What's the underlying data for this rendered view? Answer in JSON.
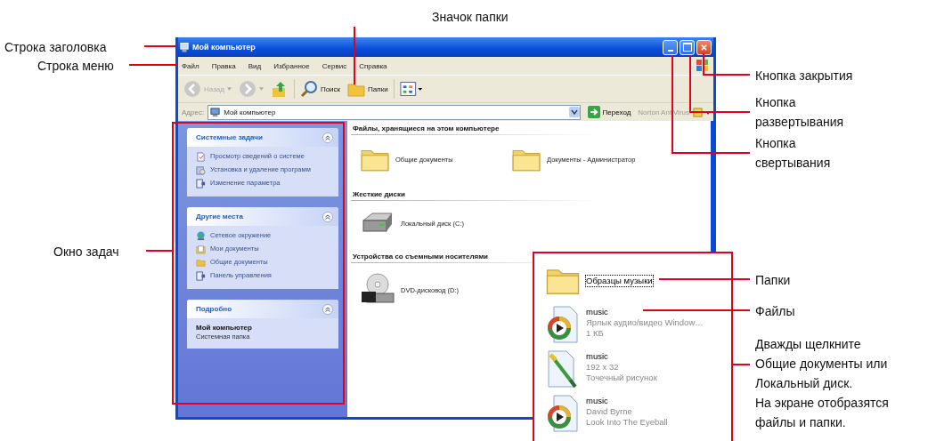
{
  "window": {
    "title": "Мой компьютер"
  },
  "menu": [
    "Файл",
    "Правка",
    "Вид",
    "Избранное",
    "Сервис",
    "Справка"
  ],
  "toolbar": [
    {
      "kind": "back",
      "label": "Назад",
      "disabled": true
    },
    {
      "kind": "forward",
      "disabled": true
    },
    {
      "kind": "up"
    },
    {
      "kind": "search",
      "label": "Поиск"
    },
    {
      "kind": "folders",
      "label": "Папки"
    },
    {
      "kind": "views"
    }
  ],
  "address": {
    "label": "Адрес:",
    "value": "Мой компьютер",
    "go": "Переход",
    "extra": "Norton AntiVirus"
  },
  "task_panes": [
    {
      "title": "Системные задачи",
      "links": [
        {
          "kind": "document",
          "text": "Просмотр сведений о системе"
        },
        {
          "kind": "programs",
          "text": "Установка и удаление программ"
        },
        {
          "kind": "settings",
          "text": "Изменение параметра"
        }
      ]
    },
    {
      "title": "Другие места",
      "links": [
        {
          "kind": "network",
          "text": "Сетевое окружение"
        },
        {
          "kind": "mydocs",
          "text": "Мои документы"
        },
        {
          "kind": "folder",
          "text": "Общие документы"
        },
        {
          "kind": "settings",
          "text": "Панель управления"
        }
      ]
    },
    {
      "title": "Подробно",
      "details": {
        "name": "Мой компьютер",
        "type": "Системная папка"
      }
    }
  ],
  "sections": [
    {
      "title": "Файлы, хранящиеся на этом компьютере",
      "items": [
        {
          "kind": "folder",
          "name": "Общие документы"
        },
        {
          "kind": "folder",
          "name": "Документы - Администратор"
        }
      ]
    },
    {
      "title": "Жесткие диски",
      "items": [
        {
          "kind": "drive",
          "name": "Локальный диск (C:)"
        }
      ]
    },
    {
      "title": "Устройства со съемными носителями",
      "items": [
        {
          "kind": "dvd",
          "name": "DVD-дисковод (D:)"
        }
      ]
    }
  ],
  "inset_items": [
    {
      "kind": "folder",
      "name": "Образцы музыки",
      "selected": true
    },
    {
      "kind": "media",
      "name": "music",
      "details": [
        "Ярлык аудио/видео Window…",
        "1 КБ"
      ],
      "selected": false
    },
    {
      "kind": "image",
      "name": "music",
      "details": [
        "192 x 32",
        "Точечный рисунок"
      ],
      "selected": false
    },
    {
      "kind": "media",
      "name": "music",
      "details": [
        "David Byrne",
        "Look Into The Eyeball"
      ],
      "selected": false
    }
  ],
  "callouts": [
    "Строка заголовка",
    "Строка меню",
    "Окно задач",
    "Значок папки",
    "Кнопка закрытия",
    "Кнопка\nразвертывания",
    "Кнопка\nсвертывания",
    "Папки",
    "Файлы",
    "Дважды щелкните\nОбщие документы или\nЛокальный диск.\nНа экране отобразятся\nфайлы и папки."
  ]
}
